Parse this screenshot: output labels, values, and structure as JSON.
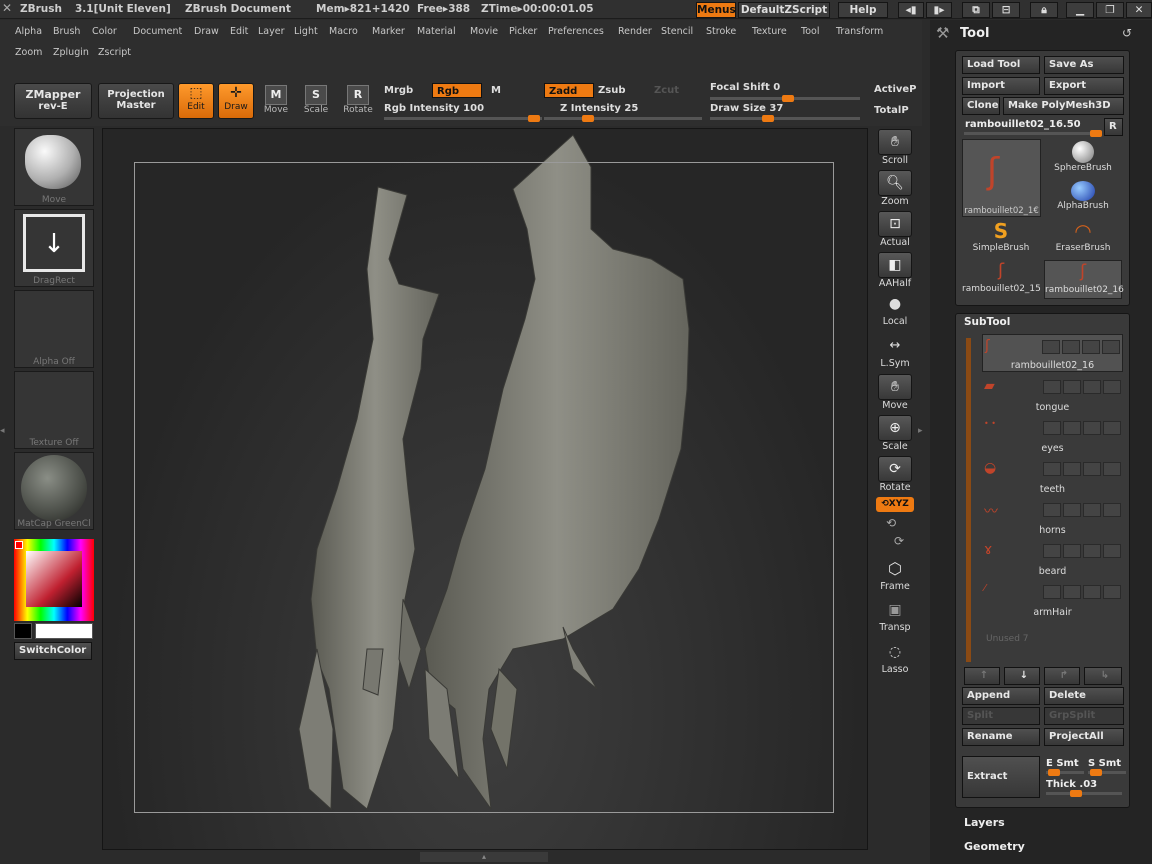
{
  "titlebar": {
    "app": "ZBrush",
    "version": "3.1[Unit Eleven]",
    "document": "ZBrush Document",
    "mem": "Mem▸821+1420",
    "free": "Free▸388",
    "ztime": "ZTime▸00:00:01.05",
    "menus_btn": "Menus",
    "script_btn": "DefaultZScript",
    "help_btn": "Help"
  },
  "menu": {
    "row1": [
      "Alpha",
      "Brush",
      "Color",
      "Document",
      "Draw",
      "Edit",
      "Layer",
      "Light",
      "Macro",
      "Marker",
      "Material",
      "Movie",
      "Picker",
      "Preferences",
      "Render",
      "Stencil",
      "Stroke",
      "Texture",
      "Tool",
      "Transform"
    ],
    "row2": [
      "Zoom",
      "Zplugin",
      "Zscript"
    ]
  },
  "toolbar": {
    "zmapper_line1": "ZMapper",
    "zmapper_line2": "rev-E",
    "projection_line1": "Projection",
    "projection_line2": "Master",
    "edit": "Edit",
    "draw": "Draw",
    "move": "Move",
    "scale": "Scale",
    "rotate": "Rotate",
    "mrgb": "Mrgb",
    "rgb": "Rgb",
    "m": "M",
    "rgb_intensity": "Rgb Intensity 100",
    "zadd": "Zadd",
    "zsub": "Zsub",
    "zcut": "Zcut",
    "z_intensity": "Z Intensity 25",
    "focal_shift": "Focal Shift 0",
    "draw_size": "Draw Size 37",
    "activep": "ActiveP",
    "totalp": "TotalP"
  },
  "left": {
    "brush": "Move",
    "stroke": "DragRect",
    "alpha": "Alpha Off",
    "texture": "Texture Off",
    "material": "MatCap GreenCl",
    "switch_color": "SwitchColor"
  },
  "right_shelf": [
    "Scroll",
    "Zoom",
    "Actual",
    "AAHalf",
    "Local",
    "L.Sym",
    "Move",
    "Scale",
    "Rotate",
    "Frame",
    "Transp",
    "Lasso"
  ],
  "xyz_label": "XYZ",
  "tool_panel": {
    "title": "Tool",
    "load": "Load Tool",
    "save": "Save As",
    "import": "Import",
    "export": "Export",
    "clone": "Clone",
    "make_polymesh": "Make PolyMesh3D",
    "current": "rambouillet02_16.50",
    "r_btn": "R",
    "thumbs": [
      "rambouillet02_1€",
      "SphereBrush",
      "AlphaBrush",
      "SimpleBrush",
      "EraserBrush",
      "rambouillet02_15",
      "rambouillet02_16"
    ]
  },
  "subtool": {
    "title": "SubTool",
    "items": [
      "rambouillet02_16",
      "tongue",
      "eyes",
      "teeth",
      "horns",
      "beard",
      "armHair"
    ],
    "unused": "Unused 7",
    "append": "Append",
    "delete": "Delete",
    "split": "Split",
    "grpsplit": "GrpSplit",
    "rename": "Rename",
    "projectall": "ProjectAll",
    "extract": "Extract",
    "e_smt": "E Smt",
    "s_smt": "S Smt",
    "thick": "Thick .03"
  },
  "tray_sections": {
    "layers": "Layers",
    "geometry": "Geometry"
  },
  "colors": {
    "accent": "#ee7a12",
    "background": "#2b2b2b",
    "canvas": "#323232"
  }
}
